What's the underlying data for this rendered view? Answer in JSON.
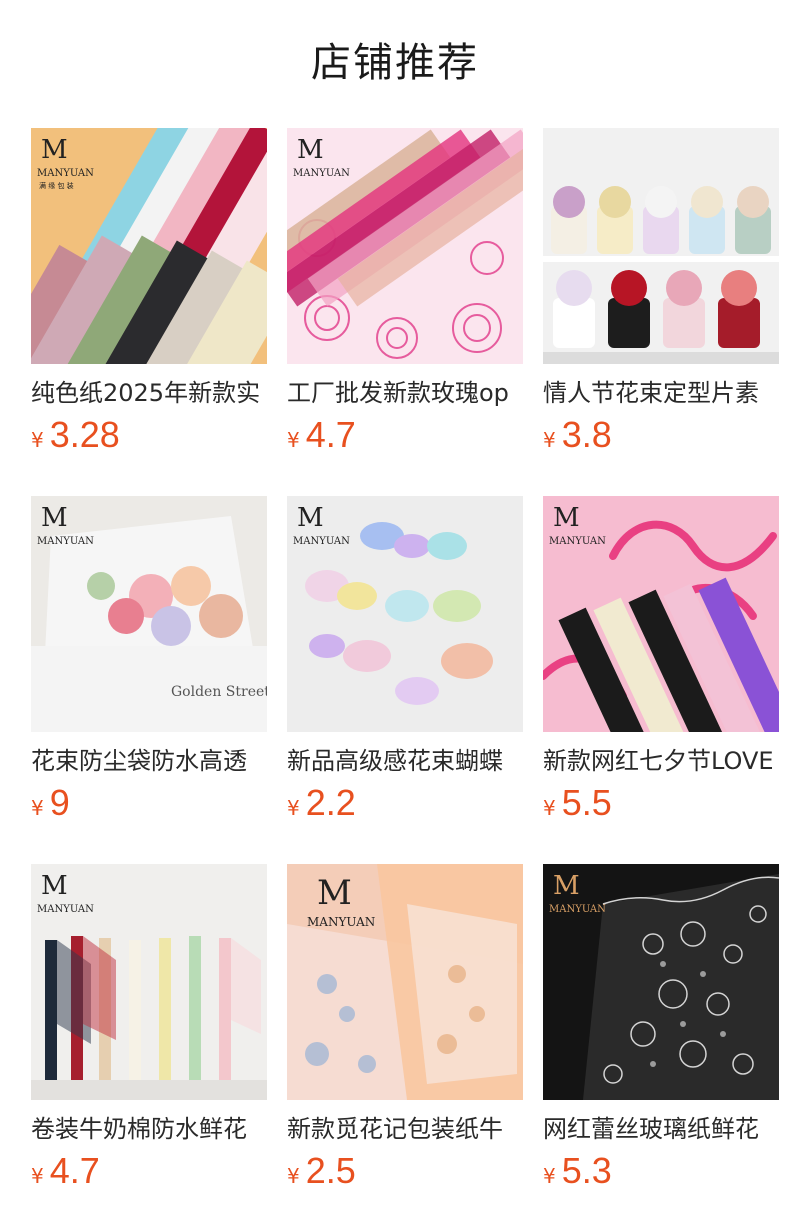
{
  "section": {
    "title": "店铺推荐"
  },
  "brand": {
    "logo_text": "MANYUAN",
    "logo_sub": "满 缘 包 装",
    "price_color": "#e8501f"
  },
  "products": [
    {
      "name": "纯色纸2025年新款实",
      "currency": "¥",
      "price": "3.28",
      "image": "solid-color-wrapping-paper"
    },
    {
      "name": "工厂批发新款玫瑰op",
      "currency": "¥",
      "price": "4.7",
      "image": "rose-pattern-opp-film"
    },
    {
      "name": "情人节花束定型片素",
      "currency": "¥",
      "price": "3.8",
      "image": "bouquet-shaping-boxes"
    },
    {
      "name": "花束防尘袋防水高透",
      "currency": "¥",
      "price": "9",
      "image": "transparent-bouquet-bag"
    },
    {
      "name": "新品高级感花束蝴蝶",
      "currency": "¥",
      "price": "2.2",
      "image": "iridescent-butterflies"
    },
    {
      "name": "新款网红七夕节LOVE",
      "currency": "¥",
      "price": "5.5",
      "image": "love-script-paper"
    },
    {
      "name": "卷装牛奶棉防水鲜花",
      "currency": "¥",
      "price": "4.7",
      "image": "milk-cotton-rolls"
    },
    {
      "name": "新款觅花记包装纸牛",
      "currency": "¥",
      "price": "2.5",
      "image": "floral-print-paper"
    },
    {
      "name": "网红蕾丝玻璃纸鲜花",
      "currency": "¥",
      "price": "5.3",
      "image": "lace-cellophane-paper"
    }
  ]
}
